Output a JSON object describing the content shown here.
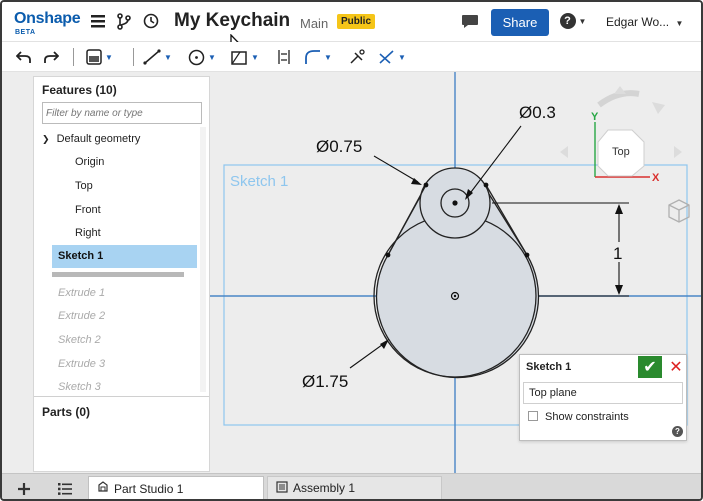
{
  "app": {
    "logo": "Onshape",
    "logo_sub": "BETA"
  },
  "header": {
    "doc_title": "My Keychain",
    "branch": "Main",
    "badge": "Public",
    "share_label": "Share",
    "help_label": "?",
    "user_label": "Edgar Wo..."
  },
  "features_panel": {
    "header": "Features (10)",
    "filter_placeholder": "Filter by name or type",
    "group_label": "Default geometry",
    "items": [
      "Origin",
      "Top",
      "Front",
      "Right"
    ],
    "selected": "Sketch 1",
    "disabled_items": [
      "Extrude 1",
      "Extrude 2",
      "Sketch 2",
      "Extrude 3",
      "Sketch 3"
    ],
    "parts_header": "Parts (0)"
  },
  "viewport": {
    "sketch_label": "Sketch 1",
    "dims": {
      "top": "Ø0.3",
      "mid": "Ø0.75",
      "big": "Ø1.75",
      "vertical": "1"
    },
    "view_cube": {
      "face": "Top",
      "y_axis": "Y",
      "x_axis": "X"
    },
    "colors": {
      "sketch_blue": "#8ec6ee",
      "axis_blue": "#4a86c6",
      "view_green": "#28a745",
      "view_red": "#d9302e"
    }
  },
  "sketch_dialog": {
    "title": "Sketch 1",
    "plane": "Top plane",
    "checkbox_label": "Show constraints",
    "help": "?"
  },
  "tabs": {
    "active": "Part Studio 1",
    "inactive": "Assembly 1"
  },
  "icons": {
    "hamburger": "hamburger-icon",
    "branch": "branch-icon",
    "history": "history-icon",
    "comment": "comment-icon",
    "undo": "undo-icon",
    "redo": "redo-icon"
  }
}
